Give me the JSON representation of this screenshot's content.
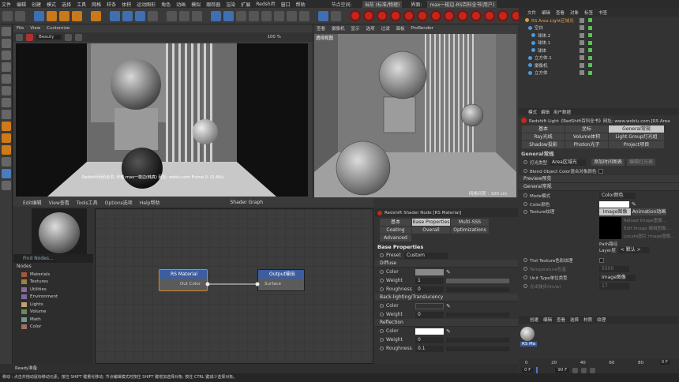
{
  "menubar": {
    "items": [
      "文件",
      "编辑",
      "创建",
      "模式",
      "选择",
      "工具",
      "网格",
      "样条",
      "体积",
      "运动图形",
      "角色",
      "动画",
      "模拟",
      "跟踪器",
      "渲染",
      "扩展",
      "Redshift",
      "窗口",
      "帮助"
    ],
    "node_space": "节点空间:",
    "node_space_value": "当前 (标准/物理)",
    "interface": "界面:",
    "interface_value": "max一梭边-RS百科全书(用户)"
  },
  "viewport1": {
    "menu": [
      "File",
      "View",
      "Customize"
    ],
    "dropdown": "Beauty",
    "zoom": "100 %",
    "caption": "Redshift百科全书, 作者:max一梭边(韩真) 网址: woblu.com   Frame 0: (0.40s)"
  },
  "viewport2": {
    "menu": [
      "查看",
      "摄像机",
      "显示",
      "选项",
      "过滤",
      "面板",
      "ProRender"
    ],
    "label": "透视视图",
    "grid": "网格间距 : 100 cm"
  },
  "shader_graph": {
    "menu": [
      "Edit编辑",
      "View查看",
      "Tools工具",
      "Options选项",
      "Help帮助"
    ],
    "title": "Shader Graph",
    "find_nodes": "Find Nodes...",
    "nodes_header": "Nodes",
    "categories": [
      "Materials",
      "Textures",
      "Utilities",
      "Environment",
      "Lights",
      "Volume",
      "Math",
      "Color"
    ],
    "category_colors": [
      "#a05a3a",
      "#a08040",
      "#8a6a9a",
      "#7a6aa0",
      "#c0a070",
      "#6a8a5a",
      "#6a9a8a",
      "#a07060"
    ],
    "rs_material": {
      "title": "RS Material",
      "port": "Out Color"
    },
    "output": {
      "title": "Output输出",
      "port": "Surface"
    }
  },
  "shader_node": {
    "title": "Redshift Shader Node [RS Material]",
    "tabs": [
      "基本",
      "Base Properties",
      "Multi-SSS",
      "Coating",
      "Overall",
      "Optimizations",
      "Advanced"
    ],
    "section": "Base Properties",
    "preset_label": "Preset",
    "preset_value": "Custom",
    "diffuse": "Diffuse",
    "color": "Color",
    "weight": "Weight",
    "weight_value": "1",
    "roughness": "Roughness",
    "roughness_value": "0",
    "backlighting": "Back-lighting/Translucency",
    "bl_color": "Color",
    "bl_weight": "Weight",
    "bl_weight_value": "0",
    "reflection": "Reflection",
    "r_color": "Color",
    "r_weight": "Weight",
    "r_weight_value": "0",
    "r_rough": "Roughness",
    "r_rough_value": "0.1"
  },
  "objects": {
    "tabs": [
      "文件",
      "编辑",
      "查看",
      "对象",
      "标签",
      "书签"
    ],
    "list": [
      "RS Area Light区域光",
      "空白",
      "球体.2",
      "球体.1",
      "球体",
      "立方体.1",
      "摄像机",
      "立方体"
    ]
  },
  "attributes": {
    "tabs": [
      "模式",
      "编辑",
      "用户数据"
    ],
    "title": "Redshift Light《RedShift百科全书》网址: www.woblu.com [RS Area",
    "tab_rows": [
      [
        "基本",
        "坐标",
        "General常规"
      ],
      [
        "Ray光线",
        "Volume体积",
        "Light Group灯光组"
      ],
      [
        "Shadow投影",
        "Photon光子",
        "Project项目"
      ]
    ],
    "general": "General常规",
    "light_type": "灯光类型",
    "light_type_value": "Area区域光",
    "add_light_btn": "添加时间图表",
    "edit_btn": "编辑灯光表",
    "blend": "Blend Object Color混合对象颜色",
    "preview": "Preview预览",
    "general2": "General常规",
    "mode": "Mode模式",
    "mode_value": "Color颜色",
    "color": "Color颜色",
    "texture": "Texture纹理",
    "tex_tabs": [
      "Image图像",
      "Animation动画"
    ],
    "reload": "Reload Image重载...",
    "edit_img": "Edit Image 编辑图像...",
    "locate": "Locate图片 Image图像...",
    "path": "Path路径",
    "layer": "Layer层",
    "layer_value": "< 默认 >",
    "tint": "Tint Texture色彩纹理",
    "temperature": "Temperature色温",
    "temp_value": "5500",
    "unit": "Unit Type单位类型",
    "unit_value": "Image图像",
    "power": "光出独步(lm/w)",
    "power_value": "17"
  },
  "materials": {
    "menu": [
      "创建",
      "编辑",
      "查看",
      "选择",
      "材质",
      "纹理"
    ],
    "item": "RS Ma"
  },
  "timeline": {
    "ticks": [
      "0",
      "20",
      "40",
      "60",
      "80"
    ],
    "frame": "0 F",
    "start": "0 F",
    "end": "90 F"
  },
  "status": {
    "text": "Ready准备"
  },
  "help": {
    "text": "移动 : 点击并拖动鼠标移动元素。按住 SHIFT 键量化移动; 节点编辑模式时按住 SHIFT 键增加选择对象; 按住 CTRL 键减少选择对象。"
  }
}
